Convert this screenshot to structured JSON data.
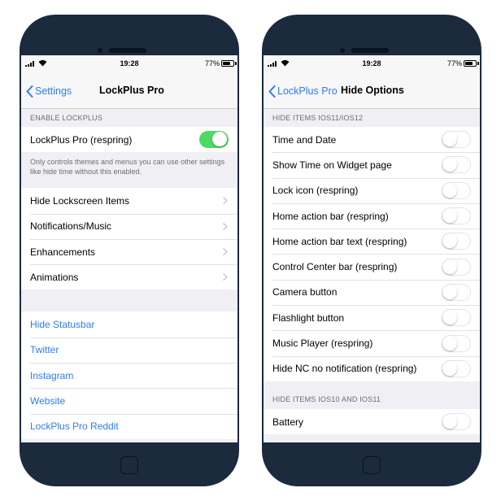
{
  "left": {
    "status": {
      "time": "19:28",
      "battery": "77%",
      "battery_level": 0.77
    },
    "nav": {
      "back_label": "Settings",
      "title": "LockPlus Pro"
    },
    "enable_section": {
      "header": "ENABLE LOCKPLUS",
      "toggle_label": "LockPlus Pro (respring)",
      "toggle_on": true,
      "footer": "Only controls themes and menus you can use other settings like hide time without this enabled."
    },
    "menu_items": [
      {
        "label": "Hide Lockscreen Items"
      },
      {
        "label": "Notifications/Music"
      },
      {
        "label": "Enhancements"
      },
      {
        "label": "Animations"
      }
    ],
    "links": [
      {
        "label": "Hide Statusbar"
      },
      {
        "label": "Twitter"
      },
      {
        "label": "Instagram"
      },
      {
        "label": "Website"
      },
      {
        "label": "LockPlus Pro Reddit"
      }
    ]
  },
  "right": {
    "status": {
      "time": "19:28",
      "battery": "77%",
      "battery_level": 0.77
    },
    "nav": {
      "back_label": "LockPlus Pro",
      "title": "Hide Options"
    },
    "section1": {
      "header": "HIDE ITEMS IOS11/IOS12",
      "items": [
        {
          "label": "Time and Date",
          "on": false
        },
        {
          "label": "Show Time on Widget page",
          "on": false
        },
        {
          "label": "Lock icon (respring)",
          "on": false
        },
        {
          "label": "Home action bar (respring)",
          "on": false
        },
        {
          "label": "Home action bar text (respring)",
          "on": false
        },
        {
          "label": "Control Center bar (respring)",
          "on": false
        },
        {
          "label": "Camera button",
          "on": false
        },
        {
          "label": "Flashlight button",
          "on": false
        },
        {
          "label": "Music Player (respring)",
          "on": false
        },
        {
          "label": "Hide NC no notification (respring)",
          "on": false
        }
      ]
    },
    "section2": {
      "header": "HIDE ITEMS IOS10 AND IOS11",
      "items": [
        {
          "label": "Battery",
          "on": false
        }
      ]
    }
  },
  "colors": {
    "accent": "#2f7bf5",
    "toggle_on": "#4cd964",
    "phone_frame": "#1b2a3d",
    "grouped_bg": "#efeff4"
  },
  "icons": [
    "back-chevron-icon",
    "disclosure-chevron-icon",
    "signal-icon",
    "wifi-icon",
    "battery-icon",
    "home-button-icon"
  ]
}
